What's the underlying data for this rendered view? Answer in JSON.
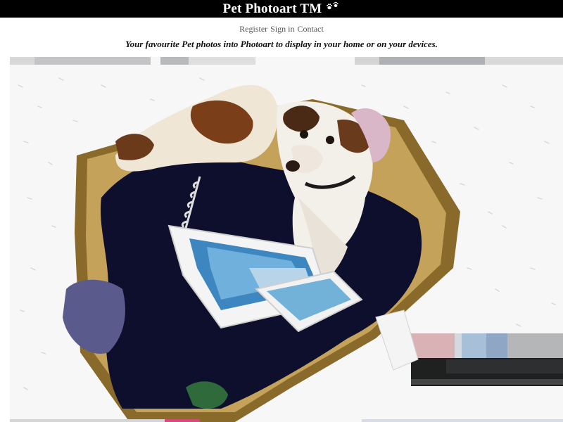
{
  "header": {
    "title": "Pet Photoart TM"
  },
  "nav": {
    "register": "Register",
    "sign_in": "Sign in",
    "contact": "Contact"
  },
  "tagline": "Your favourite Pet photos into Photoart to display in your home or on your devices.",
  "hero": {
    "icon": "paw-prints-icon"
  },
  "colors": {
    "header_bg": "#000000",
    "header_text": "#ffffff",
    "nav_text": "#555555"
  }
}
